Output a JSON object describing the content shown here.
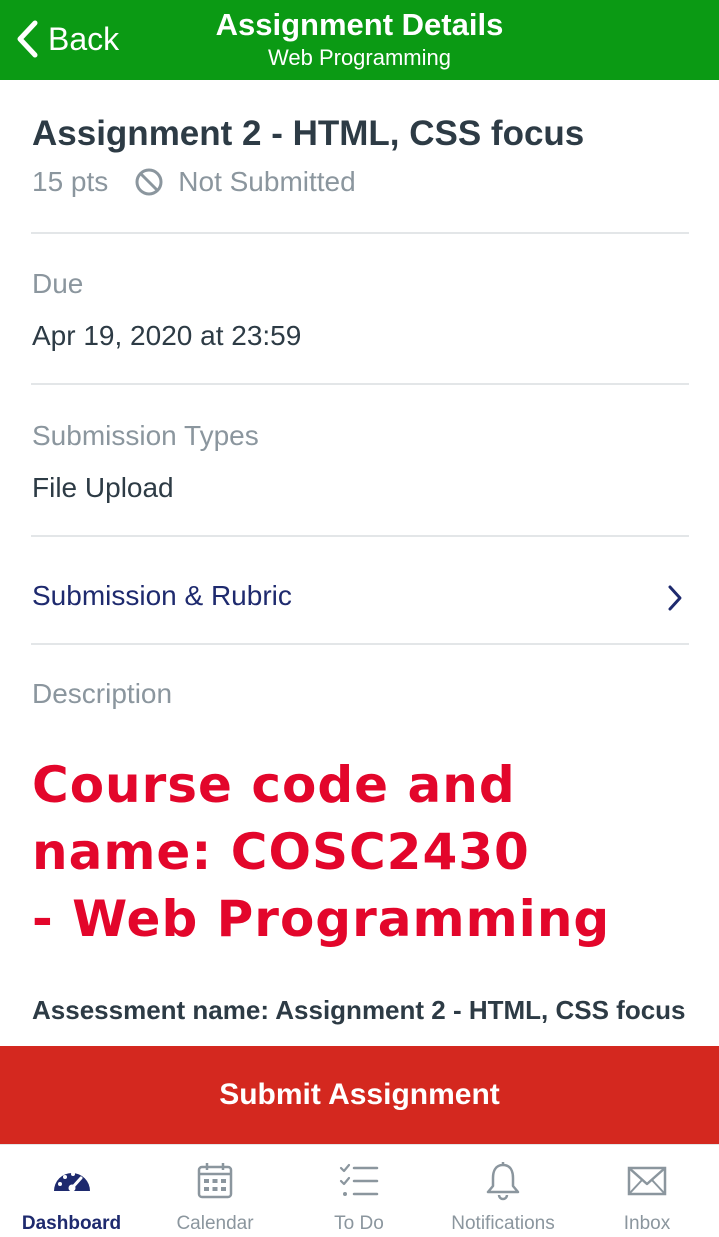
{
  "header": {
    "back_label": "Back",
    "title": "Assignment Details",
    "subtitle": "Web Programming",
    "color": "#0b9a14"
  },
  "assignment": {
    "title": "Assignment 2 - HTML, CSS focus",
    "points": "15 pts",
    "status": "Not Submitted",
    "status_icon": "no-entry-icon"
  },
  "due": {
    "label": "Due",
    "value": "Apr 19, 2020 at 23:59"
  },
  "submission_types": {
    "label": "Submission Types",
    "value": "File Upload"
  },
  "rubric": {
    "label": "Submission & Rubric",
    "icon": "chevron-right-icon"
  },
  "description": {
    "label": "Description",
    "course_lines": [
      "Course code and",
      "name: COSC2430",
      "- Web Programming"
    ],
    "assessment_line": "Assessment name: Assignment 2 - HTML, CSS focus"
  },
  "submit": {
    "label": "Submit Assignment",
    "color": "#d4281f"
  },
  "tabs": [
    {
      "label": "Dashboard",
      "icon": "dashboard-icon",
      "active": true
    },
    {
      "label": "Calendar",
      "icon": "calendar-icon",
      "active": false
    },
    {
      "label": "To Do",
      "icon": "todo-icon",
      "active": false
    },
    {
      "label": "Notifications",
      "icon": "bell-icon",
      "active": false
    },
    {
      "label": "Inbox",
      "icon": "mail-icon",
      "active": false
    }
  ]
}
